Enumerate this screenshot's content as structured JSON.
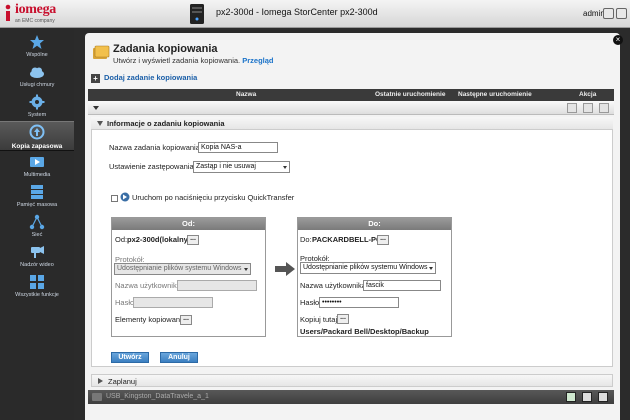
{
  "header": {
    "brand": "iomega",
    "brand_sub": "an EMC company",
    "title": "px2-300d - Iomega StorCenter px2-300d",
    "user": "admin"
  },
  "sidebar": {
    "items": [
      {
        "label": "Wspólne",
        "icon": "star-icon"
      },
      {
        "label": "Usługi chmury",
        "icon": "cloud-icon"
      },
      {
        "label": "System",
        "icon": "gear-icon"
      },
      {
        "label": "Kopia zapasowa",
        "icon": "backup-icon",
        "active": true
      },
      {
        "label": "Multimedia",
        "icon": "media-icon"
      },
      {
        "label": "Pamięć masowa",
        "icon": "storage-icon"
      },
      {
        "label": "Sieć",
        "icon": "network-icon"
      },
      {
        "label": "Nadzór wideo",
        "icon": "camera-icon"
      },
      {
        "label": "Wszystkie funkcje",
        "icon": "grid-icon"
      }
    ]
  },
  "page": {
    "title": "Zadania kopiowania",
    "description": "Utwórz i wyświetl zadania kopiowania.",
    "overview_link": "Przegląd",
    "add_job": "Dodaj zadanie kopiowania"
  },
  "table": {
    "columns": [
      "Nazwa",
      "Ostatnie uruchomienie",
      "Następne uruchomienie",
      "Akcja"
    ]
  },
  "job_info": {
    "section_title": "Informacje o zadaniu kopiowania",
    "name_label": "Nazwa zadania kopiowania:",
    "name_value": "Kopia NAS-a",
    "overwrite_label": "Ustawienie zastępowania:",
    "overwrite_value": "Zastąp i nie usuwaj",
    "quicktransfer_label": "Uruchom po naciśnięciu przycisku QuickTransfer"
  },
  "from_box": {
    "title": "Od:",
    "device_label": "Od:",
    "device_value": "px2-300d(lokalny)",
    "protocol_label": "Protokół:",
    "protocol_value": "Udostępnianie plików systemu Windows",
    "username_label": "Nazwa użytkownika:",
    "password_label": "Hasło:",
    "items_label": "Elementy kopiowane:"
  },
  "to_box": {
    "title": "Do:",
    "device_label": "Do:",
    "device_value": "PACKARDBELL-PC",
    "protocol_label": "Protokół:",
    "protocol_value": "Udostępnianie plików systemu Windows",
    "username_label": "Nazwa użytkownika:",
    "username_value": "fascik",
    "password_label": "Hasło:",
    "password_value": "••••••••",
    "copy_here_label": "Kopiuj tutaj:",
    "path": "Users/Packard Bell/Desktop/Backup"
  },
  "actions": {
    "create": "Utwórz",
    "cancel": "Anuluj",
    "dots": "..."
  },
  "schedule": {
    "label": "Zaplanuj"
  },
  "footer": {
    "job_name": "USB_Kingston_DataTravele_a_1"
  }
}
